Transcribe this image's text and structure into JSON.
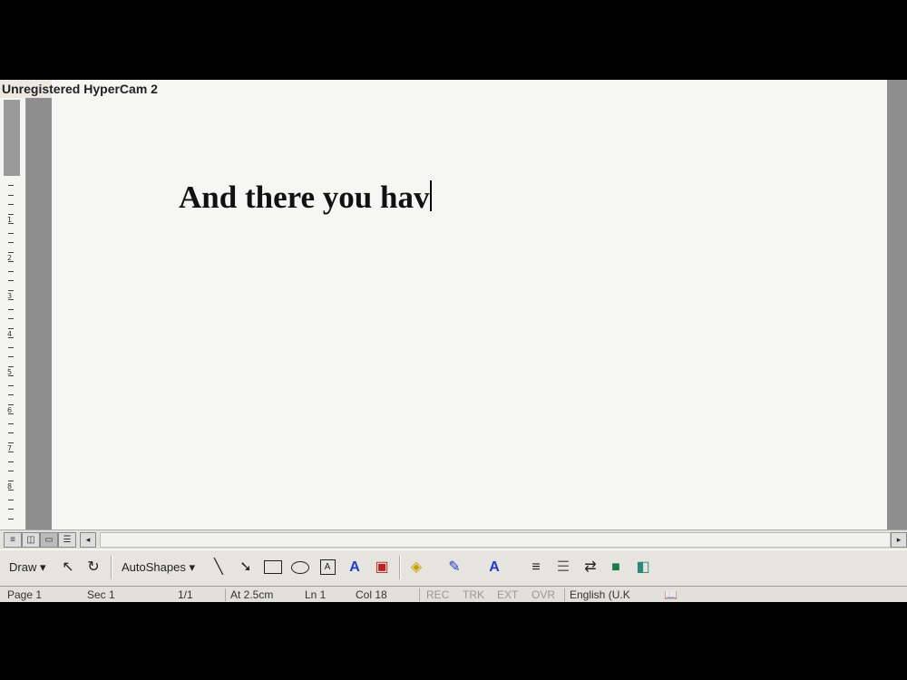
{
  "watermark": "Unregistered HyperCam 2",
  "document": {
    "text": "And there you hav"
  },
  "ruler": {
    "numbers": [
      "1",
      "2",
      "3",
      "4",
      "5",
      "6",
      "7",
      "8"
    ]
  },
  "view_buttons": [
    "≡",
    "◫",
    "▭",
    "☰"
  ],
  "scroll": {
    "left_arrow": "◂",
    "right_arrow": "▸"
  },
  "drawing_toolbar": {
    "draw_label": "Draw ▾",
    "autoshapes_label": "AutoShapes ▾",
    "icons": [
      "select-pointer-icon",
      "free-rotate-icon",
      "line-icon",
      "arrow-icon",
      "rectangle-icon",
      "oval-icon",
      "text-box-icon",
      "wordart-icon",
      "clip-art-icon",
      "fill-color-icon",
      "line-color-icon",
      "font-color-icon",
      "line-style-icon",
      "dash-style-icon",
      "arrow-style-icon",
      "shadow-icon",
      "3d-icon"
    ]
  },
  "status_bar": {
    "page": "Page 1",
    "sec": "Sec 1",
    "pages": "1/1",
    "at": "At 2.5cm",
    "ln": "Ln 1",
    "col": "Col 18",
    "rec": "REC",
    "trk": "TRK",
    "ext": "EXT",
    "ovr": "OVR",
    "language": "English (U.K"
  }
}
